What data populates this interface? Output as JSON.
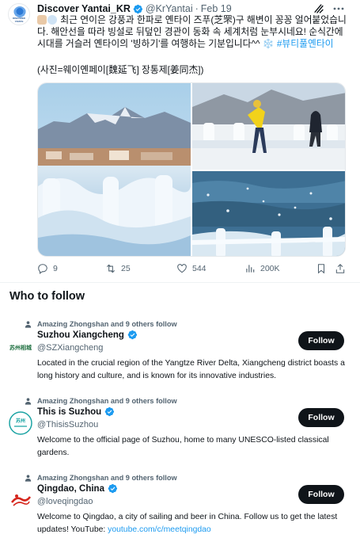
{
  "tweet": {
    "author_name": "Discover Yantai_KR",
    "author_handle": "@KrYantai",
    "separator": "·",
    "date": "Feb 19",
    "avatar_text": "DISCOVER YANTAI",
    "body_part1": "최근 연이은 강풍과 한파로 옌타이 즈푸(芝罘)구 해변이 꽁꽁 얼어붙었습니다. 해안선을 따라 빙설로 뒤덮인 경관이 동화 속 세계처럼 눈부시네요! 순식간에 시대를 거슬러 옌타이의 '빙하기'를 여행하는 기분입니다^^",
    "snow_emoji": "❄️",
    "hashtag": "#뷰티풀옌타이",
    "credit": "(사진=웨이옌페이[魏延飞] 장통제[姜同杰])",
    "stats": {
      "replies": "9",
      "reposts": "25",
      "likes": "544",
      "views": "200K"
    }
  },
  "who_to_follow": {
    "title": "Who to follow",
    "follow_label": "Follow",
    "accounts": [
      {
        "social_context": "Amazing Zhongshan and 9 others follow",
        "name": "Suzhou Xiangcheng",
        "handle": "@SZXiangcheng",
        "bio": "Located in the crucial region of the Yangtze River Delta, Xiangcheng district boasts a long history and culture, and is known for its innovative industries.",
        "avatar_text": "苏州相城"
      },
      {
        "social_context": "Amazing Zhongshan and 9 others follow",
        "name": "This is Suzhou",
        "handle": "@ThisisSuzhou",
        "bio": "Welcome to the official page of Suzhou, home to many UNESCO-listed classical gardens.",
        "avatar_text": "苏州"
      },
      {
        "social_context": "Amazing Zhongshan and 9 others follow",
        "name": "Qingdao, China",
        "handle": "@loveqingdao",
        "bio": "Welcome to Qingdao, a city of sailing and beer in China. Follow us to get the latest updates! YouTube:",
        "bio_link": "youtube.com/c/meetqingdao"
      }
    ]
  },
  "colors": {
    "accent": "#1d9bf0",
    "text_primary": "#0f1419",
    "text_secondary": "#536471",
    "verified_badge": "#1d9bf0",
    "follow_button_bg": "#0f1419"
  }
}
